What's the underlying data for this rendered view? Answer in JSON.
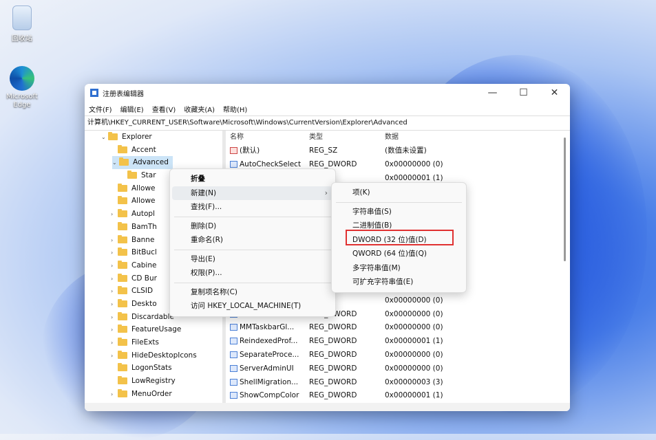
{
  "desktop": {
    "icons": [
      {
        "label": "回收站",
        "icon": "recycle-bin-icon"
      },
      {
        "label": "Microsoft Edge",
        "icon": "edge-icon"
      }
    ]
  },
  "window": {
    "title": "注册表编辑器",
    "buttons": {
      "minimize": "—",
      "maximize": "☐",
      "close": "✕"
    },
    "menu": [
      "文件(F)",
      "编辑(E)",
      "查看(V)",
      "收藏夹(A)",
      "帮助(H)"
    ],
    "address": "计算机\\HKEY_CURRENT_USER\\Software\\Microsoft\\Windows\\CurrentVersion\\Explorer\\Advanced"
  },
  "tree": [
    {
      "label": "Explorer",
      "chevron": "v",
      "indent": 0
    },
    {
      "label": "Accent",
      "chevron": "",
      "indent": 1
    },
    {
      "label": "Advanced",
      "chevron": "v",
      "indent": 1,
      "selected": true
    },
    {
      "label": "Star",
      "chevron": "",
      "indent": 2
    },
    {
      "label": "Allowe",
      "chevron": "",
      "indent": 1
    },
    {
      "label": "Allowe",
      "chevron": "",
      "indent": 1
    },
    {
      "label": "Autopl",
      "chevron": ">",
      "indent": 1
    },
    {
      "label": "BamTh",
      "chevron": "",
      "indent": 1
    },
    {
      "label": "Banne",
      "chevron": ">",
      "indent": 1
    },
    {
      "label": "BitBucl",
      "chevron": ">",
      "indent": 1
    },
    {
      "label": "Cabine",
      "chevron": ">",
      "indent": 1
    },
    {
      "label": "CD Bur",
      "chevron": ">",
      "indent": 1
    },
    {
      "label": "CLSID",
      "chevron": ">",
      "indent": 1
    },
    {
      "label": "Deskto",
      "chevron": ">",
      "indent": 1
    },
    {
      "label": "Discardable",
      "chevron": ">",
      "indent": 1
    },
    {
      "label": "FeatureUsage",
      "chevron": ">",
      "indent": 1
    },
    {
      "label": "FileExts",
      "chevron": ">",
      "indent": 1
    },
    {
      "label": "HideDesktopIcons",
      "chevron": ">",
      "indent": 1
    },
    {
      "label": "LogonStats",
      "chevron": "",
      "indent": 1
    },
    {
      "label": "LowRegistry",
      "chevron": "",
      "indent": 1
    },
    {
      "label": "MenuOrder",
      "chevron": ">",
      "indent": 1
    }
  ],
  "values": {
    "headers": [
      "名称",
      "类型",
      "数据"
    ],
    "rows": [
      {
        "name": "(默认)",
        "type": "REG_SZ",
        "data": "(数值未设置)",
        "icon": "sz"
      },
      {
        "name": "AutoCheckSelect",
        "type": "REG_DWORD",
        "data": "0x00000000 (0)",
        "icon": "dw"
      },
      {
        "name": "",
        "type": "WORD",
        "data": "0x00000001 (1)",
        "icon": ""
      },
      {
        "name": "",
        "type": "",
        "data": "",
        "icon": ""
      },
      {
        "name": "",
        "type": "",
        "data": "",
        "icon": ""
      },
      {
        "name": "",
        "type": "",
        "data": "",
        "icon": ""
      },
      {
        "name": "",
        "type": "",
        "data": "",
        "icon": ""
      },
      {
        "name": "",
        "type": "",
        "data": "",
        "icon": ""
      },
      {
        "name": "",
        "type": "",
        "data": "",
        "icon": ""
      },
      {
        "name": "",
        "type": "",
        "data": "",
        "icon": ""
      },
      {
        "name": "",
        "type": "WORD",
        "data": "0x00000001 (1)",
        "icon": ""
      },
      {
        "name": "",
        "type": "WORD",
        "data": "0x00000000 (0)",
        "icon": ""
      },
      {
        "name": "MMTaskbarEn...",
        "type": "REG_DWORD",
        "data": "0x00000000 (0)",
        "icon": "dw"
      },
      {
        "name": "MMTaskbarGl...",
        "type": "REG_DWORD",
        "data": "0x00000000 (0)",
        "icon": "dw"
      },
      {
        "name": "ReindexedProf...",
        "type": "REG_DWORD",
        "data": "0x00000001 (1)",
        "icon": "dw"
      },
      {
        "name": "SeparateProce...",
        "type": "REG_DWORD",
        "data": "0x00000000 (0)",
        "icon": "dw"
      },
      {
        "name": "ServerAdminUI",
        "type": "REG_DWORD",
        "data": "0x00000000 (0)",
        "icon": "dw"
      },
      {
        "name": "ShellMigration...",
        "type": "REG_DWORD",
        "data": "0x00000003 (3)",
        "icon": "dw"
      },
      {
        "name": "ShowCompColor",
        "type": "REG_DWORD",
        "data": "0x00000001 (1)",
        "icon": "dw"
      }
    ]
  },
  "context_menu": {
    "items": [
      {
        "label": "折叠",
        "bold": true
      },
      {
        "label": "新建(N)",
        "submenu": true,
        "highlight": true
      },
      {
        "label": "查找(F)..."
      },
      {
        "sep": true
      },
      {
        "label": "删除(D)"
      },
      {
        "label": "重命名(R)"
      },
      {
        "sep": true
      },
      {
        "label": "导出(E)"
      },
      {
        "label": "权限(P)..."
      },
      {
        "sep": true
      },
      {
        "label": "复制项名称(C)"
      },
      {
        "label": "访问 HKEY_LOCAL_MACHINE(T)"
      }
    ],
    "arrow": "›"
  },
  "submenu": {
    "items": [
      {
        "label": "项(K)"
      },
      {
        "sep": true
      },
      {
        "label": "字符串值(S)"
      },
      {
        "label": "二进制值(B)"
      },
      {
        "label": "DWORD (32 位)值(D)",
        "boxed": true
      },
      {
        "label": "QWORD (64 位)值(Q)"
      },
      {
        "label": "多字符串值(M)"
      },
      {
        "label": "可扩充字符串值(E)"
      }
    ]
  },
  "colors": {
    "highlight_box": "#e03030",
    "selection": "#cce4f7",
    "accent": "#2f6fd0"
  }
}
